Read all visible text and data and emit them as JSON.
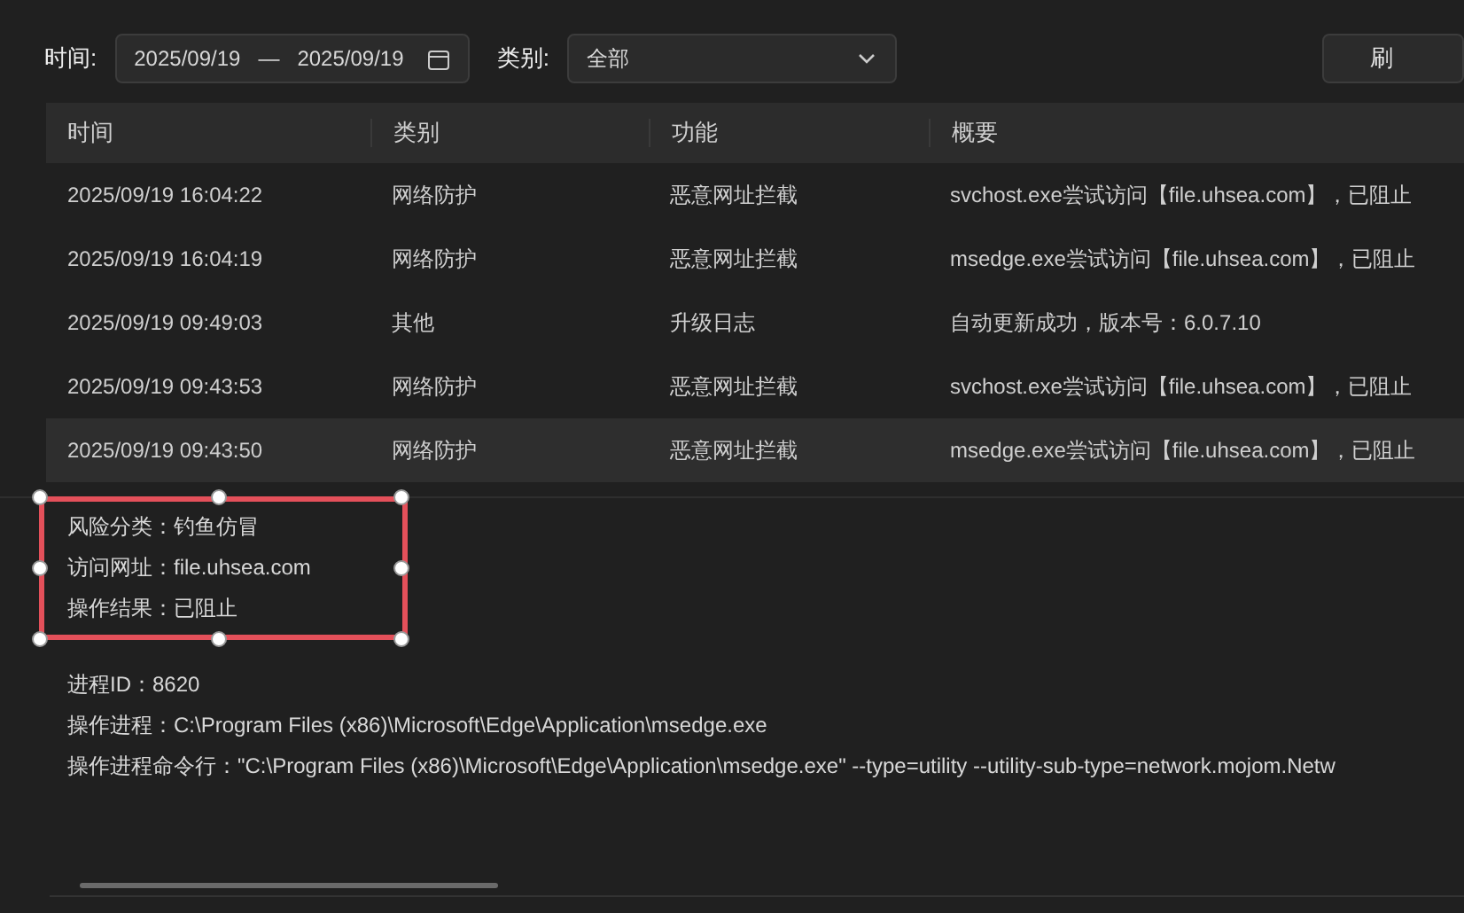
{
  "filters": {
    "time_label": "时间:",
    "date_start": "2025/09/19",
    "date_separator": "—",
    "date_end": "2025/09/19",
    "category_label": "类别:",
    "category_value": "全部",
    "refresh_button": "刷"
  },
  "table": {
    "columns": [
      "时间",
      "类别",
      "功能",
      "概要"
    ],
    "rows": [
      {
        "cells": [
          "2025/09/19 16:04:22",
          "网络防护",
          "恶意网址拦截",
          "svchost.exe尝试访问【file.uhsea.com】，已阻止"
        ],
        "selected": false
      },
      {
        "cells": [
          "2025/09/19 16:04:19",
          "网络防护",
          "恶意网址拦截",
          "msedge.exe尝试访问【file.uhsea.com】，已阻止"
        ],
        "selected": false
      },
      {
        "cells": [
          "2025/09/19 09:49:03",
          "其他",
          "升级日志",
          "自动更新成功，版本号：6.0.7.10"
        ],
        "selected": false
      },
      {
        "cells": [
          "2025/09/19 09:43:53",
          "网络防护",
          "恶意网址拦截",
          "svchost.exe尝试访问【file.uhsea.com】，已阻止"
        ],
        "selected": false
      },
      {
        "cells": [
          "2025/09/19 09:43:50",
          "网络防护",
          "恶意网址拦截",
          "msedge.exe尝试访问【file.uhsea.com】，已阻止"
        ],
        "selected": true
      }
    ]
  },
  "details": {
    "highlighted_lines": [
      "风险分类：钓鱼仿冒",
      "访问网址：file.uhsea.com",
      "操作结果：已阻止"
    ],
    "lines": [
      "进程ID：8620",
      "操作进程：C:\\Program Files (x86)\\Microsoft\\Edge\\Application\\msedge.exe",
      "操作进程命令行：\"C:\\Program Files (x86)\\Microsoft\\Edge\\Application\\msedge.exe\" --type=utility --utility-sub-type=network.mojom.Netw"
    ]
  }
}
